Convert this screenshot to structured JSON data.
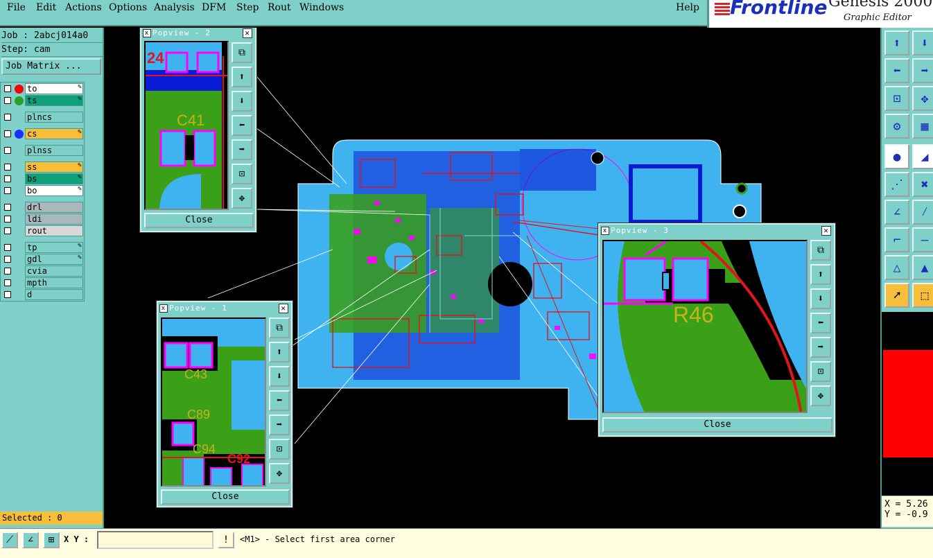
{
  "menu": [
    "File",
    "Edit",
    "Actions",
    "Options",
    "Analysis",
    "DFM",
    "Step",
    "Rout",
    "Windows"
  ],
  "help": "Help",
  "logo": {
    "brand": "Frontline",
    "product": "Genesis 2000 -",
    "subtitle": "Graphic Editor"
  },
  "job": {
    "job_label": "Job : 2abcj014a0",
    "step_label": "Step: cam",
    "matrix_button": "Job Matrix ..."
  },
  "layers": [
    {
      "name": "to",
      "color": "#ffffff",
      "dot": "#ff0000",
      "edit": true
    },
    {
      "name": "ts",
      "color": "#0fa07a",
      "dot": "#2aa02a",
      "edit": true
    },
    {
      "name": "plncs",
      "color": "#7fd0c8",
      "dot": "",
      "edit": false
    },
    {
      "name": "cs",
      "color": "#f7be3c",
      "dot": "#1a2dff",
      "edit": true
    },
    {
      "name": "plnss",
      "color": "#7fd0c8",
      "dot": "",
      "edit": false
    },
    {
      "name": "ss",
      "color": "#f7be3c",
      "dot": "",
      "edit": true
    },
    {
      "name": "bs",
      "color": "#0fa07a",
      "dot": "",
      "edit": true
    },
    {
      "name": "bo",
      "color": "#ffffff",
      "dot": "",
      "edit": true
    },
    {
      "name": "drl",
      "color": "#aab7bd",
      "dot": "",
      "edit": false
    },
    {
      "name": "ldi",
      "color": "#aab7bd",
      "dot": "",
      "edit": false
    },
    {
      "name": "rout",
      "color": "#d8d8d8",
      "dot": "",
      "edit": false
    },
    {
      "name": "tp",
      "color": "#7fd0c8",
      "dot": "",
      "edit": true
    },
    {
      "name": "gdl",
      "color": "#7fd0c8",
      "dot": "",
      "edit": true
    },
    {
      "name": "cvia",
      "color": "#7fd0c8",
      "dot": "",
      "edit": false
    },
    {
      "name": "mpth",
      "color": "#7fd0c8",
      "dot": "",
      "edit": false
    },
    {
      "name": "d",
      "color": "#7fd0c8",
      "dot": "",
      "edit": false
    }
  ],
  "selected": "Selected : 0",
  "statusbar": {
    "xy_label": "X Y :",
    "xy_value": "",
    "message": "<M1> - Select first area corner",
    "alert": "!"
  },
  "coords": {
    "x": "X = 5.26",
    "y": "Y = -0.9"
  },
  "popups": {
    "p1": {
      "title": "Popview - 1",
      "close": "Close",
      "labels": [
        "C43",
        "C89",
        "C94",
        "C92"
      ]
    },
    "p2": {
      "title": "Popview - 2",
      "close": "Close",
      "labels": [
        "24",
        "C41"
      ]
    },
    "p3": {
      "title": "Popview - 3",
      "close": "Close",
      "labels": [
        "R46"
      ]
    }
  },
  "colors": {
    "panel": "#7fd0c8",
    "copper": "#3fb3f0",
    "fill": "#3aa018",
    "pad": "#ff00ff",
    "trace": "#e0151f",
    "silk": "#c7b21a",
    "mask": "#0a1bd6"
  }
}
